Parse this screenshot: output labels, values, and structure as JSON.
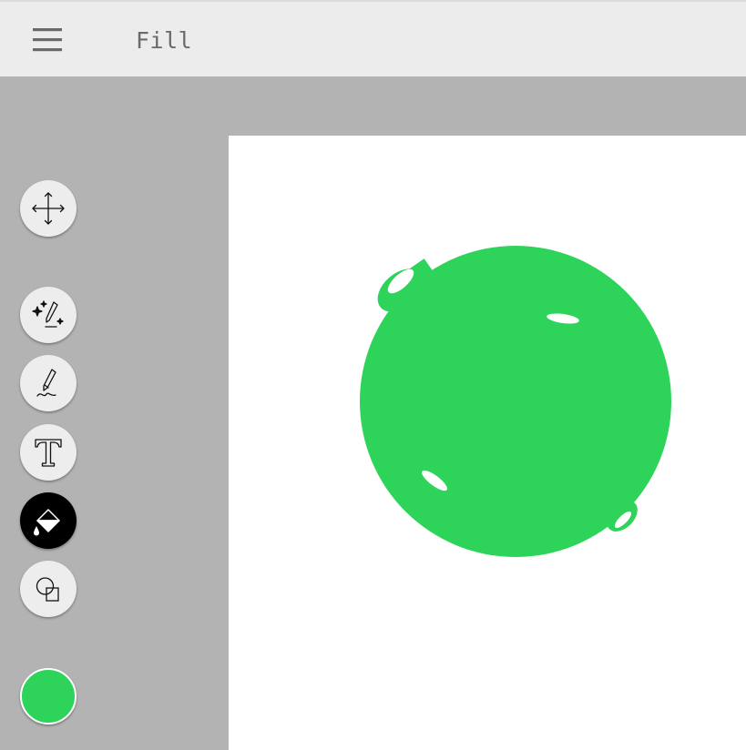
{
  "header": {
    "title": "Fill",
    "menu_icon": "hamburger-menu-icon"
  },
  "toolbar": {
    "tools": [
      {
        "name": "move",
        "icon": "move-arrows-icon",
        "active": false
      },
      {
        "name": "magic-draw",
        "icon": "sparkle-pen-icon",
        "active": false
      },
      {
        "name": "draw",
        "icon": "pencil-icon",
        "active": false
      },
      {
        "name": "text",
        "icon": "text-icon",
        "active": false
      },
      {
        "name": "fill",
        "icon": "paint-bucket-icon",
        "active": true
      },
      {
        "name": "shapes",
        "icon": "shapes-icon",
        "active": false
      }
    ],
    "current_color": "#2ed35a"
  },
  "canvas": {
    "background": "#ffffff",
    "drawing": {
      "shape": "ornament-ball",
      "fill_color": "#2ed35a"
    }
  },
  "colors": {
    "app_background": "#b3b3b3",
    "header_background": "#ececec",
    "tool_button": "#ededed",
    "active_tool": "#000000"
  }
}
